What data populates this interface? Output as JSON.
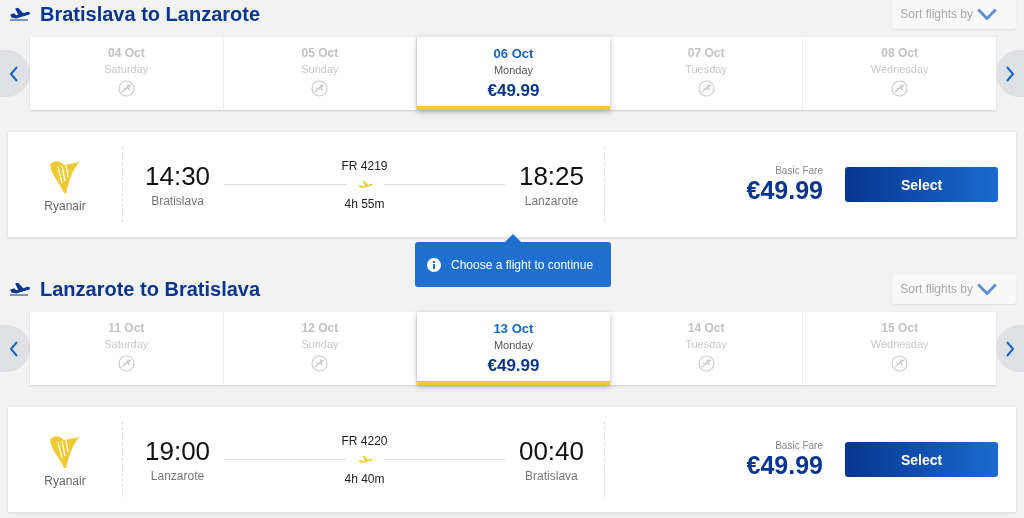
{
  "sections": [
    {
      "title": "Bratislava to Lanzarote",
      "sort_label": "Sort flights by",
      "dates": [
        {
          "date": "04 Oct",
          "weekday": "Saturday",
          "selected": false
        },
        {
          "date": "05 Oct",
          "weekday": "Sunday",
          "selected": false
        },
        {
          "date": "06 Oct",
          "weekday": "Monday",
          "price": "€49.99",
          "selected": true
        },
        {
          "date": "07 Oct",
          "weekday": "Tuesday",
          "selected": false
        },
        {
          "date": "08 Oct",
          "weekday": "Wednesday",
          "selected": false
        }
      ],
      "flight": {
        "airline": "Ryanair",
        "flight_number": "FR 4219",
        "departure_time": "14:30",
        "departure_city": "Bratislava",
        "duration": "4h 55m",
        "arrival_time": "18:25",
        "arrival_city": "Lanzarote",
        "fare_label": "Basic Fare",
        "price": "€49.99",
        "button": "Select"
      }
    },
    {
      "title": "Lanzarote to Bratislava",
      "sort_label": "Sort flights by",
      "dates": [
        {
          "date": "11 Oct",
          "weekday": "Saturday",
          "selected": false
        },
        {
          "date": "12 Oct",
          "weekday": "Sunday",
          "selected": false
        },
        {
          "date": "13 Oct",
          "weekday": "Monday",
          "price": "€49.99",
          "selected": true
        },
        {
          "date": "14 Oct",
          "weekday": "Tuesday",
          "selected": false
        },
        {
          "date": "15 Oct",
          "weekday": "Wednesday",
          "selected": false
        }
      ],
      "flight": {
        "airline": "Ryanair",
        "flight_number": "FR 4220",
        "departure_time": "19:00",
        "departure_city": "Lanzarote",
        "duration": "4h 40m",
        "arrival_time": "00:40",
        "arrival_city": "Bratislava",
        "fare_label": "Basic Fare",
        "price": "€49.99",
        "button": "Select"
      }
    }
  ],
  "tooltip": {
    "text": "Choose a flight to continue"
  }
}
